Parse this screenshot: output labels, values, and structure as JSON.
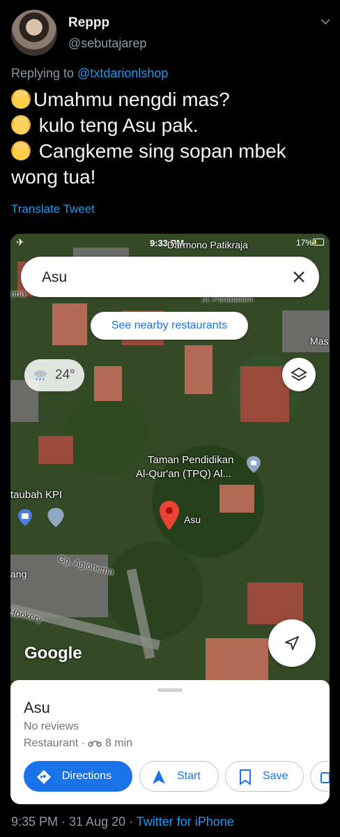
{
  "tweet": {
    "display_name": "Reppp",
    "handle": "@sebutajarep",
    "replying_prefix": "Replying to",
    "replying_to": "@txtdarionlshop",
    "lines": [
      "Umahmu nengdi mas?",
      "kulo teng Asu pak.",
      "Cangkeme sing sopan mbek",
      "wong tua!"
    ],
    "translate_label": "Translate Tweet",
    "timestamp": "9:35 PM · 31 Aug 20 · ",
    "source": "Twitter for iPhone"
  },
  "map_screenshot": {
    "status_time": "9:33 PM",
    "status_battery": "17%",
    "search_value": "Asu",
    "nearby_label": "See nearby restaurants",
    "temperature": "24°",
    "labels": {
      "top1": "Darmono Patikraja",
      "top2": "Jl. Penatusan",
      "left_edge": "ena",
      "right_edge": "Mas",
      "tpq": "Taman Pendidikan",
      "tpq2": "Al-Qur'an (TPQ) Al...",
      "taubah": "taubah KPI",
      "pin": "Asu",
      "street": "Gg. Aglonema",
      "ang": "ang",
      "hookery": "Hookery"
    },
    "google_logo": "Google",
    "place": {
      "name": "Asu",
      "reviews": "No reviews",
      "category": "Restaurant · ",
      "travel_time": "8 min"
    },
    "actions": {
      "directions": "Directions",
      "start": "Start",
      "save": "Save"
    },
    "colors": {
      "accent": "#1a73e8",
      "pin": "#ea4335"
    }
  }
}
